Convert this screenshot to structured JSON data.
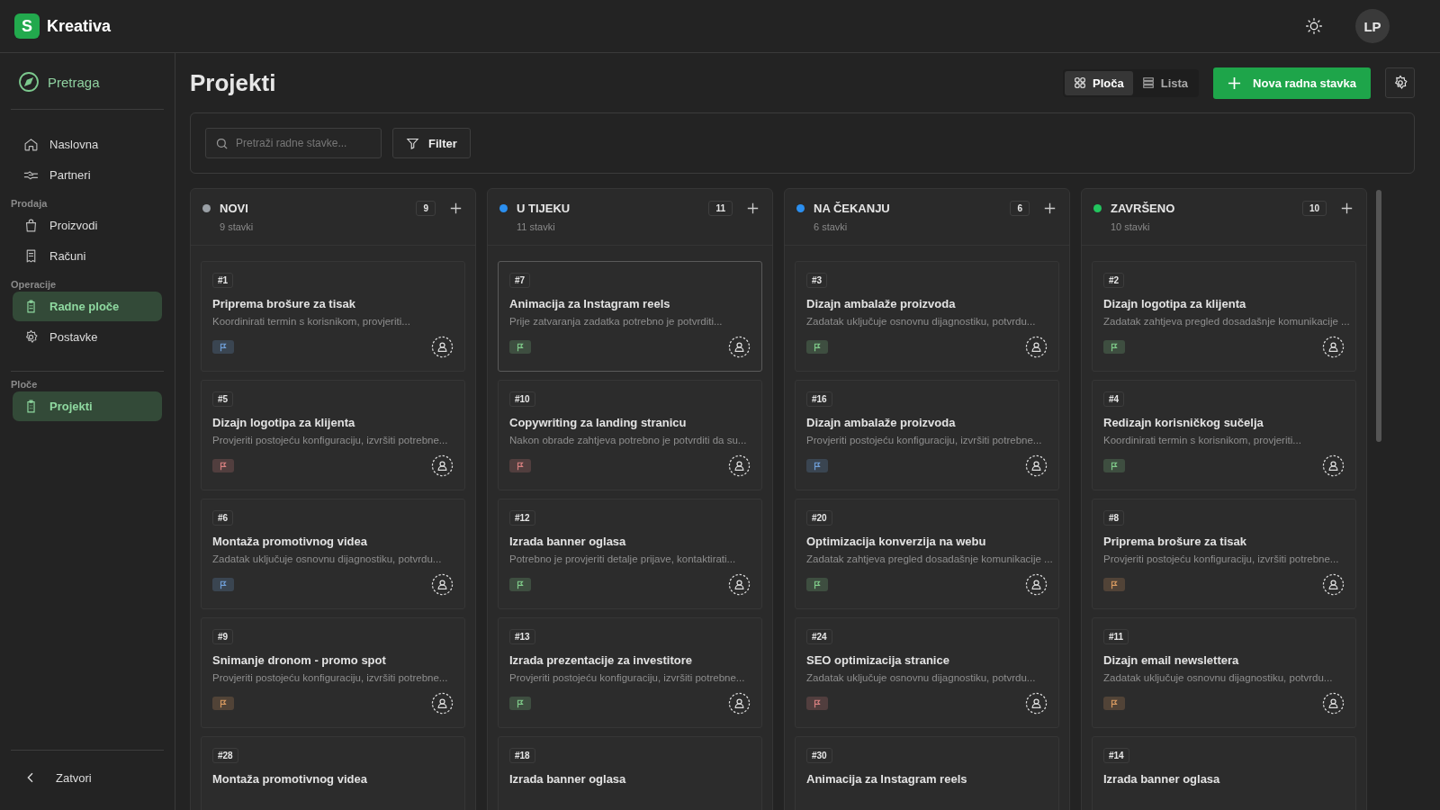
{
  "app": {
    "logo_letter": "S",
    "name": "Kreativa",
    "avatar": "LP"
  },
  "sidebar": {
    "search": "Pretraga",
    "items": [
      {
        "label": "Naslovna",
        "kind": "home",
        "selected": false
      },
      {
        "label": "Partneri",
        "kind": "handshake",
        "selected": false
      }
    ],
    "sections": [
      {
        "title": "Prodaja",
        "items": [
          {
            "label": "Proizvodi",
            "kind": "bag",
            "selected": false
          },
          {
            "label": "Računi",
            "kind": "receipt",
            "selected": false
          }
        ]
      },
      {
        "title": "Operacije",
        "items": [
          {
            "label": "Radne ploče",
            "kind": "clipboard",
            "selected": true
          },
          {
            "label": "Postavke",
            "kind": "gear",
            "selected": false
          }
        ]
      }
    ],
    "boards": {
      "title": "Ploče",
      "items": [
        {
          "label": "Projekti",
          "kind": "clipboard",
          "selected": true
        }
      ]
    },
    "close": "Zatvori"
  },
  "page": {
    "title": "Projekti",
    "views": [
      {
        "label": "Ploča",
        "kind": "grid",
        "selected": true
      },
      {
        "label": "Lista",
        "kind": "list",
        "selected": false
      }
    ],
    "new_button": "Nova radna stavka",
    "search": {
      "placeholder": "Pretraži radne stavke..."
    },
    "filter": "Filter"
  },
  "columns": [
    {
      "title": "NOVI",
      "color": "#9aa0a6",
      "count": "9",
      "subtitle": "9 stavki",
      "cards": [
        {
          "id": "#1",
          "title": "Priprema brošure za tisak",
          "description": "Koordinirati termin s korisnikom, provjeriti...",
          "color": "#6f9fd8",
          "selected": false
        },
        {
          "id": "#5",
          "title": "Dizajn logotipa za klijenta",
          "description": "Provjeriti postojeću konfiguraciju, izvršiti potrebne...",
          "color": "#d88080",
          "selected": false
        },
        {
          "id": "#6",
          "title": "Montaža promotivnog videa",
          "description": "Zadatak uključuje osnovnu dijagnostiku, potvrdu...",
          "color": "#6f9fd8",
          "selected": false
        },
        {
          "id": "#9",
          "title": "Snimanje dronom - promo spot",
          "description": "Provjeriti postojeću konfiguraciju, izvršiti potrebne...",
          "color": "#d89a60",
          "selected": false
        },
        {
          "id": "#28",
          "title": "Montaža promotivnog videa",
          "selected": false
        }
      ]
    },
    {
      "title": "U TIJEKU",
      "color": "#2b8ff0",
      "count": "11",
      "subtitle": "11 stavki",
      "cards": [
        {
          "id": "#7",
          "title": "Animacija za Instagram reels",
          "description": "Prije zatvaranja zadatka potrebno je potvrditi...",
          "color": "#80cc8a",
          "selected": true
        },
        {
          "id": "#10",
          "title": "Copywriting za landing stranicu",
          "description": "Nakon obrade zahtjeva potrebno je potvrditi da su...",
          "color": "#d88080",
          "selected": false
        },
        {
          "id": "#12",
          "title": "Izrada banner oglasa",
          "description": "Potrebno je provjeriti detalje prijave, kontaktirati...",
          "color": "#80cc8a",
          "selected": false
        },
        {
          "id": "#13",
          "title": "Izrada prezentacije za investitore",
          "description": "Provjeriti postojeću konfiguraciju, izvršiti potrebne...",
          "color": "#80cc8a",
          "selected": false
        },
        {
          "id": "#18",
          "title": "Izrada banner oglasa",
          "selected": false
        }
      ]
    },
    {
      "title": "NA ČEKANJU",
      "color": "#2b8ff0",
      "count": "6",
      "subtitle": "6 stavki",
      "cards": [
        {
          "id": "#3",
          "title": "Dizajn ambalaže proizvoda",
          "description": "Zadatak uključuje osnovnu dijagnostiku, potvrdu...",
          "color": "#80cc8a",
          "selected": false
        },
        {
          "id": "#16",
          "title": "Dizajn ambalaže proizvoda",
          "description": "Provjeriti postojeću konfiguraciju, izvršiti potrebne...",
          "color": "#6f9fd8",
          "selected": false
        },
        {
          "id": "#20",
          "title": "Optimizacija konverzija na webu",
          "description": "Zadatak zahtjeva pregled dosadašnje komunikacije ...",
          "color": "#80cc8a",
          "selected": false
        },
        {
          "id": "#24",
          "title": "SEO optimizacija stranice",
          "description": "Zadatak uključuje osnovnu dijagnostiku, potvrdu...",
          "color": "#d88080",
          "selected": false
        },
        {
          "id": "#30",
          "title": "Animacija za Instagram reels",
          "selected": false
        }
      ]
    },
    {
      "title": "ZAVRŠENO",
      "color": "#22c55e",
      "count": "10",
      "subtitle": "10 stavki",
      "cards": [
        {
          "id": "#2",
          "title": "Dizajn logotipa za klijenta",
          "description": "Zadatak zahtjeva pregled dosadašnje komunikacije ...",
          "color": "#80cc8a",
          "selected": false
        },
        {
          "id": "#4",
          "title": "Redizajn korisničkog sučelja",
          "description": "Koordinirati termin s korisnikom, provjeriti...",
          "color": "#80cc8a",
          "selected": false
        },
        {
          "id": "#8",
          "title": "Priprema brošure za tisak",
          "description": "Provjeriti postojeću konfiguraciju, izvršiti potrebne...",
          "color": "#d89a60",
          "selected": false
        },
        {
          "id": "#11",
          "title": "Dizajn email newslettera",
          "description": "Zadatak uključuje osnovnu dijagnostiku, potvrdu...",
          "color": "#d89a60",
          "selected": false
        },
        {
          "id": "#14",
          "title": "Izrada banner oglasa",
          "selected": false
        }
      ]
    }
  ]
}
